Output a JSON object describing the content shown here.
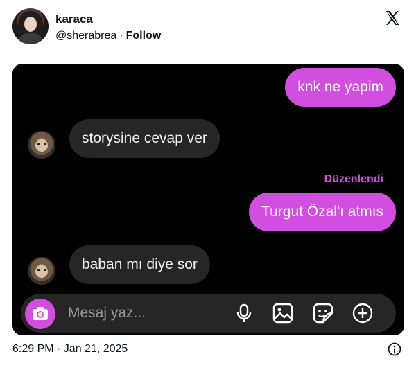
{
  "header": {
    "display_name": "karaca",
    "handle": "@sherabrea",
    "separator": "·",
    "follow_label": "Follow"
  },
  "chat": {
    "messages": [
      {
        "side": "sent",
        "text": "knk ne yapim"
      },
      {
        "side": "received",
        "text": "storysine cevap ver"
      },
      {
        "side": "sent",
        "text": "Turgut Özal'ı atmıs",
        "edited_label": "Düzenlendi"
      },
      {
        "side": "received",
        "text": "baban mı diye sor"
      }
    ],
    "composer": {
      "placeholder": "Mesaj yaz..."
    },
    "icons": [
      "camera-icon",
      "microphone-icon",
      "image-icon",
      "sticker-icon",
      "add-icon"
    ]
  },
  "footer": {
    "timestamp": "6:29 PM · Jan 21, 2025"
  },
  "colors": {
    "accent": "#d24ee0",
    "chat_background": "#000000",
    "received_bubble": "#262626"
  }
}
